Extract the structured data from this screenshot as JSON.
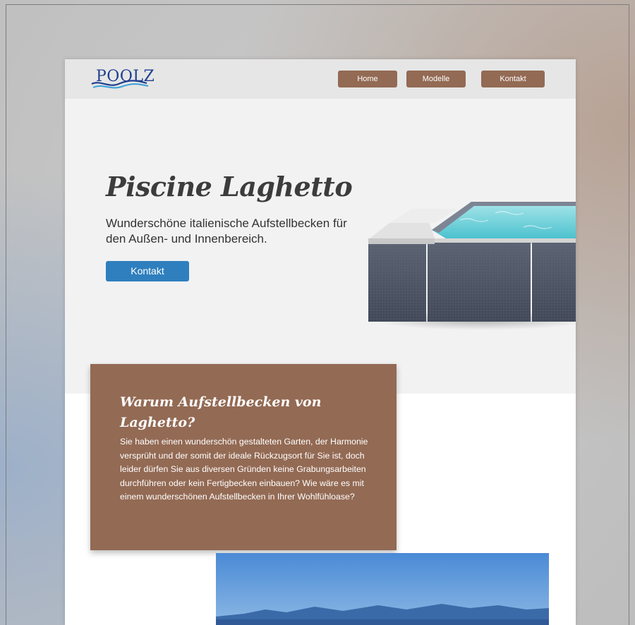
{
  "brand": {
    "logo_text": "POOLZ"
  },
  "nav": {
    "items": [
      {
        "label": "Home"
      },
      {
        "label": "Modelle"
      },
      {
        "label": "Kontakt"
      }
    ]
  },
  "hero": {
    "title": "Piscine Laghetto",
    "subtitle": "Wunderschöne italienische Aufstellbecken für den Außen- und Innenbereich.",
    "button_label": "Kontakt"
  },
  "info": {
    "title": "Warum Aufstellbecken von Laghetto?",
    "body": "Sie haben einen wunderschön gestalteten Garten, der Harmonie versprüht und der somit der ideale Rückzugsort für Sie ist, doch leider dürfen Sie aus diversen Gründen keine Grabungsarbeiten durchführen oder kein Fertigbecken einbauen? Wie wäre es mit einem wunderschönen Aufstellbecken in Ihrer Wohlfühloase?"
  },
  "colors": {
    "brand_brown": "#936a54",
    "accent_blue": "#2f7fbe",
    "logo_blue": "#1f3f8f"
  }
}
